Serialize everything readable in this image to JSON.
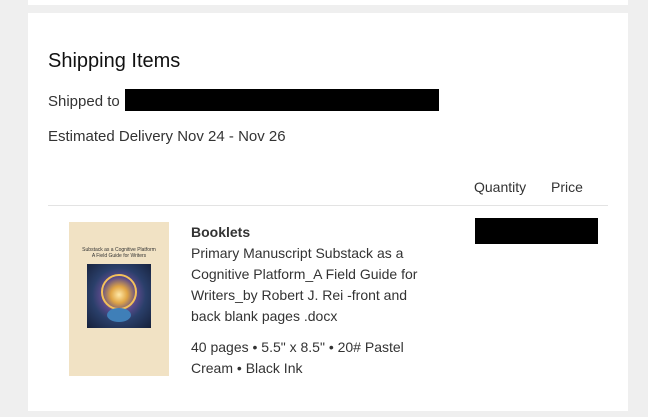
{
  "section": {
    "title": "Shipping Items",
    "shipped_to_label": "Shipped to",
    "estimated_delivery": "Estimated Delivery Nov 24 - Nov 26"
  },
  "table": {
    "columns": [
      "Quantity",
      "Price"
    ]
  },
  "item": {
    "name": "Booklets",
    "description": "Primary Manuscript Substack as a Cognitive Platform_A Field Guide for Writers_by Robert J. Rei -front and back blank pages .docx",
    "specs": "40 pages • 5.5\" x 8.5\" • 20# Pastel Cream • Black Ink",
    "thumbnail": {
      "title_line1": "Substack as a Cognitive Platform",
      "title_line2": "A Field Guide for Writers"
    }
  },
  "colors": {
    "page_background": "#efefef",
    "card_background": "#ffffff",
    "redaction": "#000000",
    "thumbnail_paper": "#f1e2c4"
  }
}
